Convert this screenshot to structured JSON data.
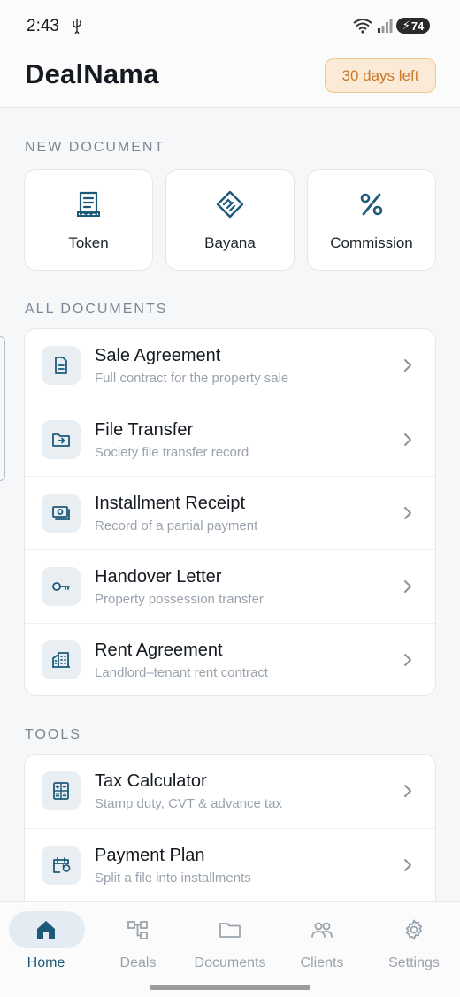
{
  "status_bar": {
    "time": "2:43",
    "battery": "74"
  },
  "header": {
    "title": "DealNama",
    "trial_badge": "30 days left"
  },
  "sections": {
    "new_document": "NEW DOCUMENT",
    "all_documents": "ALL DOCUMENTS",
    "tools": "TOOLS"
  },
  "quick_actions": [
    {
      "label": "Token",
      "icon": "receipt-icon"
    },
    {
      "label": "Bayana",
      "icon": "handshake-icon"
    },
    {
      "label": "Commission",
      "icon": "percent-icon"
    }
  ],
  "documents": [
    {
      "title": "Sale Agreement",
      "subtitle": "Full contract for the property sale",
      "icon": "document-icon"
    },
    {
      "title": "File Transfer",
      "subtitle": "Society file transfer record",
      "icon": "folder-transfer-icon"
    },
    {
      "title": "Installment Receipt",
      "subtitle": "Record of a partial payment",
      "icon": "cash-icon"
    },
    {
      "title": "Handover Letter",
      "subtitle": "Property possession transfer",
      "icon": "key-icon"
    },
    {
      "title": "Rent Agreement",
      "subtitle": "Landlord–tenant rent contract",
      "icon": "building-icon"
    }
  ],
  "tools": [
    {
      "title": "Tax Calculator",
      "subtitle": "Stamp duty, CVT & advance tax",
      "icon": "calculator-icon"
    },
    {
      "title": "Payment Plan",
      "subtitle": "Split a file into installments",
      "icon": "calendar-icon"
    }
  ],
  "nav": [
    {
      "label": "Home",
      "icon": "home-icon",
      "active": true
    },
    {
      "label": "Deals",
      "icon": "deals-icon",
      "active": false
    },
    {
      "label": "Documents",
      "icon": "folder-icon",
      "active": false
    },
    {
      "label": "Clients",
      "icon": "users-icon",
      "active": false
    },
    {
      "label": "Settings",
      "icon": "gear-icon",
      "active": false
    }
  ],
  "colors": {
    "accent": "#1d5a7a",
    "badge_bg": "#fbead5",
    "badge_text": "#c9792a",
    "icon_bg": "#e9eef2"
  }
}
